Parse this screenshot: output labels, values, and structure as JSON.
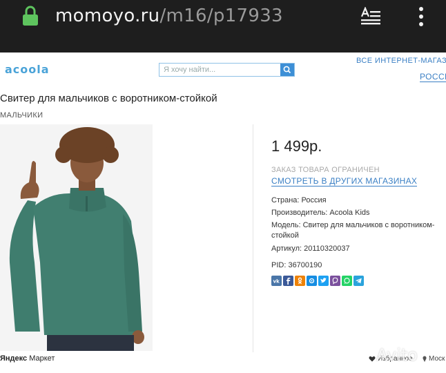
{
  "browser": {
    "url_host": "momoyo.ru",
    "url_path": "/m16/p17933",
    "icons": {
      "lock": "lock-icon",
      "reader": "reader-mode-icon",
      "menu": "more-vertical-icon"
    }
  },
  "header": {
    "logo_text": "acoola",
    "search_placeholder": "Я хочу найти...",
    "all_shops_label": "ВСЕ ИНТЕРНЕТ-МАГАЗИН",
    "country_label": "РОССИ",
    "colors": {
      "brand": "#4aa3d8",
      "link": "#3a7fc4",
      "search_button": "#3d8fd6"
    }
  },
  "product": {
    "title": "Свитер для мальчиков с воротником-стойкой",
    "category": "МАЛЬЧИКИ",
    "price": "1 499р.",
    "order_limited": "ЗАКАЗ ТОВАРА ОГРАНИЧЕН",
    "other_shops_link": "СМОТРЕТЬ В ДРУГИХ МАГАЗИНАХ",
    "country": "Страна: Россия",
    "manufacturer": "Производитель: Acoola Kids",
    "model": "Модель: Свитер для мальчиков с воротником-стойкой",
    "article": "Артикул: 20110320037",
    "pid": "PID: 36700190",
    "image_alt_colors": {
      "sweater": "#3f7d6e",
      "skin": "#8a5a3c",
      "hair": "#6b4226"
    }
  },
  "share": {
    "buttons": [
      {
        "name": "vk",
        "color": "#4a76a8"
      },
      {
        "name": "facebook",
        "color": "#3b5998"
      },
      {
        "name": "odnoklassniki",
        "color": "#ee8208"
      },
      {
        "name": "moimir",
        "color": "#168de2"
      },
      {
        "name": "twitter",
        "color": "#1da1f2"
      },
      {
        "name": "viber",
        "color": "#7b519d"
      },
      {
        "name": "whatsapp",
        "color": "#25d366"
      },
      {
        "name": "telegram",
        "color": "#2aa3dc"
      }
    ]
  },
  "footer": {
    "yandex_label_1": "Яндекс",
    "yandex_label_2": "Маркет",
    "favorites_label": "Избранное",
    "city_label": "Моск",
    "watermark": "Avito"
  }
}
